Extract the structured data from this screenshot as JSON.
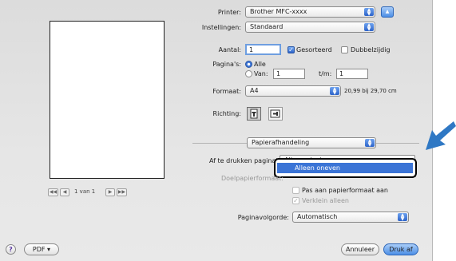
{
  "printer": {
    "label": "Printer:",
    "value": "Brother MFC-xxxx"
  },
  "presets": {
    "label": "Instellingen:",
    "value": "Standaard"
  },
  "copies": {
    "label": "Aantal:",
    "value": "1",
    "collated_label": "Gesorteerd",
    "collated": true,
    "duplex_label": "Dubbelzijdig",
    "duplex": false
  },
  "pages": {
    "label": "Pagina's:",
    "all_label": "Alle",
    "from_label": "Van:",
    "from_value": "1",
    "to_label": "t/m:",
    "to_value": "1"
  },
  "format": {
    "label": "Formaat:",
    "value": "A4",
    "size_text": "20,99 bij 29,70 cm"
  },
  "orientation": {
    "label": "Richting:"
  },
  "section_popup": {
    "value": "Papierafhandeling"
  },
  "pages_to_print": {
    "label": "Af te drukken pagina's:",
    "current": "Alle pagina's",
    "dropdown": [
      "Alleen oneven"
    ]
  },
  "dest_paper": {
    "label": "Doelpapierformaat:",
    "fit_label": "Pas aan papierformaat aan",
    "shrink_label": "Verklein alleen"
  },
  "page_order": {
    "label": "Paginavolgorde:",
    "value": "Automatisch"
  },
  "preview": {
    "page_text": "1 van 1"
  },
  "footer": {
    "help": "?",
    "pdf_label": "PDF ▾",
    "cancel_label": "Annuleer",
    "print_label": "Druk af"
  },
  "colors": {
    "accent": "#3b74d6",
    "callout_arrow": "#2f78c4"
  }
}
